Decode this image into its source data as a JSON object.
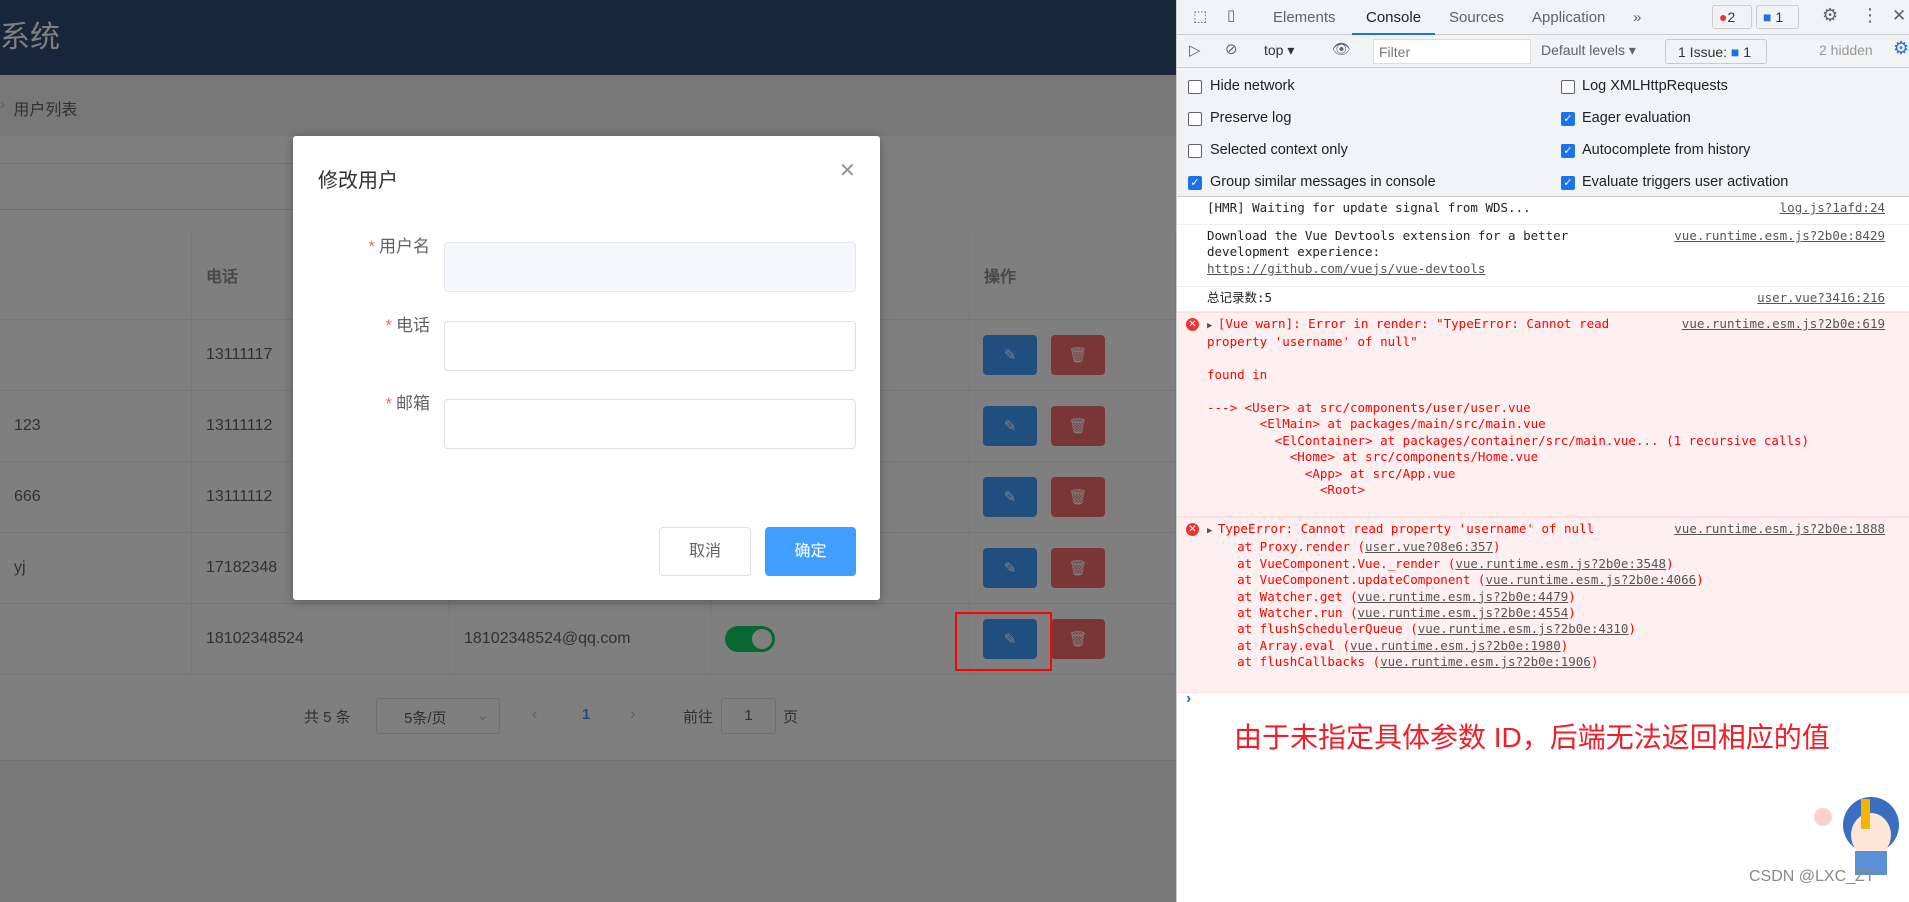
{
  "app": {
    "title": "系统",
    "breadcrumb": "用户列表"
  },
  "table": {
    "headers": [
      "",
      "电话",
      "",
      "",
      "操作"
    ],
    "rows": [
      {
        "name": "",
        "phone": "13111117",
        "email": ""
      },
      {
        "name": "123",
        "phone": "13111112",
        "email": ""
      },
      {
        "name": "666",
        "phone": "13111112",
        "email": ""
      },
      {
        "name": "yj",
        "phone": "17182348",
        "email": ""
      },
      {
        "name": "",
        "phone": "18102348524",
        "email": "18102348524@qq.com",
        "status": true
      }
    ]
  },
  "pagination": {
    "total": "共 5 条",
    "page_size": "5条/页",
    "current": "1",
    "goto_label": "前往",
    "goto_value": "1",
    "page_suffix": "页"
  },
  "dialog": {
    "title": "修改用户",
    "fields": [
      {
        "label": "用户名",
        "value": ""
      },
      {
        "label": "电话",
        "value": ""
      },
      {
        "label": "邮箱",
        "value": ""
      }
    ],
    "cancel": "取消",
    "confirm": "确定"
  },
  "devtools": {
    "tabs": [
      "Elements",
      "Console",
      "Sources",
      "Application"
    ],
    "active_tab": "Console",
    "more": "»",
    "error_count": "2",
    "message_count": "1",
    "context": "top",
    "filter_placeholder": "Filter",
    "levels": "Default levels",
    "issues_label": "1 Issue:",
    "issues_count": "1",
    "hidden": "2 hidden",
    "settings_left": [
      {
        "label": "Hide network",
        "checked": false
      },
      {
        "label": "Preserve log",
        "checked": false
      },
      {
        "label": "Selected context only",
        "checked": false
      },
      {
        "label": "Group similar messages in console",
        "checked": true
      }
    ],
    "settings_right": [
      {
        "label": "Log XMLHttpRequests",
        "checked": false
      },
      {
        "label": "Eager evaluation",
        "checked": true
      },
      {
        "label": "Autocomplete from history",
        "checked": true
      },
      {
        "label": "Evaluate triggers user activation",
        "checked": true
      }
    ],
    "messages": [
      {
        "text": "[HMR] Waiting for update signal from WDS...",
        "source": "log.js?1afd:24"
      },
      {
        "text": "Download the Vue Devtools extension for a better\ndevelopment experience:",
        "link": "https://github.com/vuejs/vue-devtools",
        "source": "vue.runtime.esm.js?2b0e:8429"
      },
      {
        "text": "总记录数:5",
        "source": "user.vue?3416:216"
      },
      {
        "text": "[Vue warn]: Error in render: \"TypeError: Cannot read\nproperty 'username' of null\"\n\nfound in\n\n---> <User> at src/components/user/user.vue\n       <ElMain> at packages/main/src/main.vue\n         <ElContainer> at packages/container/src/main.vue... (1 recursive calls)\n           <Home> at src/components/Home.vue\n             <App> at src/App.vue\n               <Root>",
        "source": "vue.runtime.esm.js?2b0e:619"
      },
      {
        "text": "TypeError: Cannot read property 'username' of null",
        "source": "vue.runtime.esm.js?2b0e:1888",
        "stack": [
          [
            "at Proxy.render (",
            "user.vue?08e6:357"
          ],
          [
            "at VueComponent.Vue._render (",
            "vue.runtime.esm.js?2b0e:3548"
          ],
          [
            "at VueComponent.updateComponent (",
            "vue.runtime.esm.js?2b0e:4066"
          ],
          [
            "at Watcher.get (",
            "vue.runtime.esm.js?2b0e:4479"
          ],
          [
            "at Watcher.run (",
            "vue.runtime.esm.js?2b0e:4554"
          ],
          [
            "at flushSchedulerQueue (",
            "vue.runtime.esm.js?2b0e:4310"
          ],
          [
            "at Array.eval (",
            "vue.runtime.esm.js?2b0e:1980"
          ],
          [
            "at flushCallbacks (",
            "vue.runtime.esm.js?2b0e:1906"
          ]
        ]
      }
    ],
    "prompt": "›"
  },
  "annotation": "由于未指定具体参数 ID，后端无法返回相应的值",
  "watermark": "CSDN @LXC_ZT",
  "colors": {
    "primary": "#409eff",
    "danger": "#f56c6c",
    "success": "#13ce66",
    "annotation": "#f01e28"
  }
}
